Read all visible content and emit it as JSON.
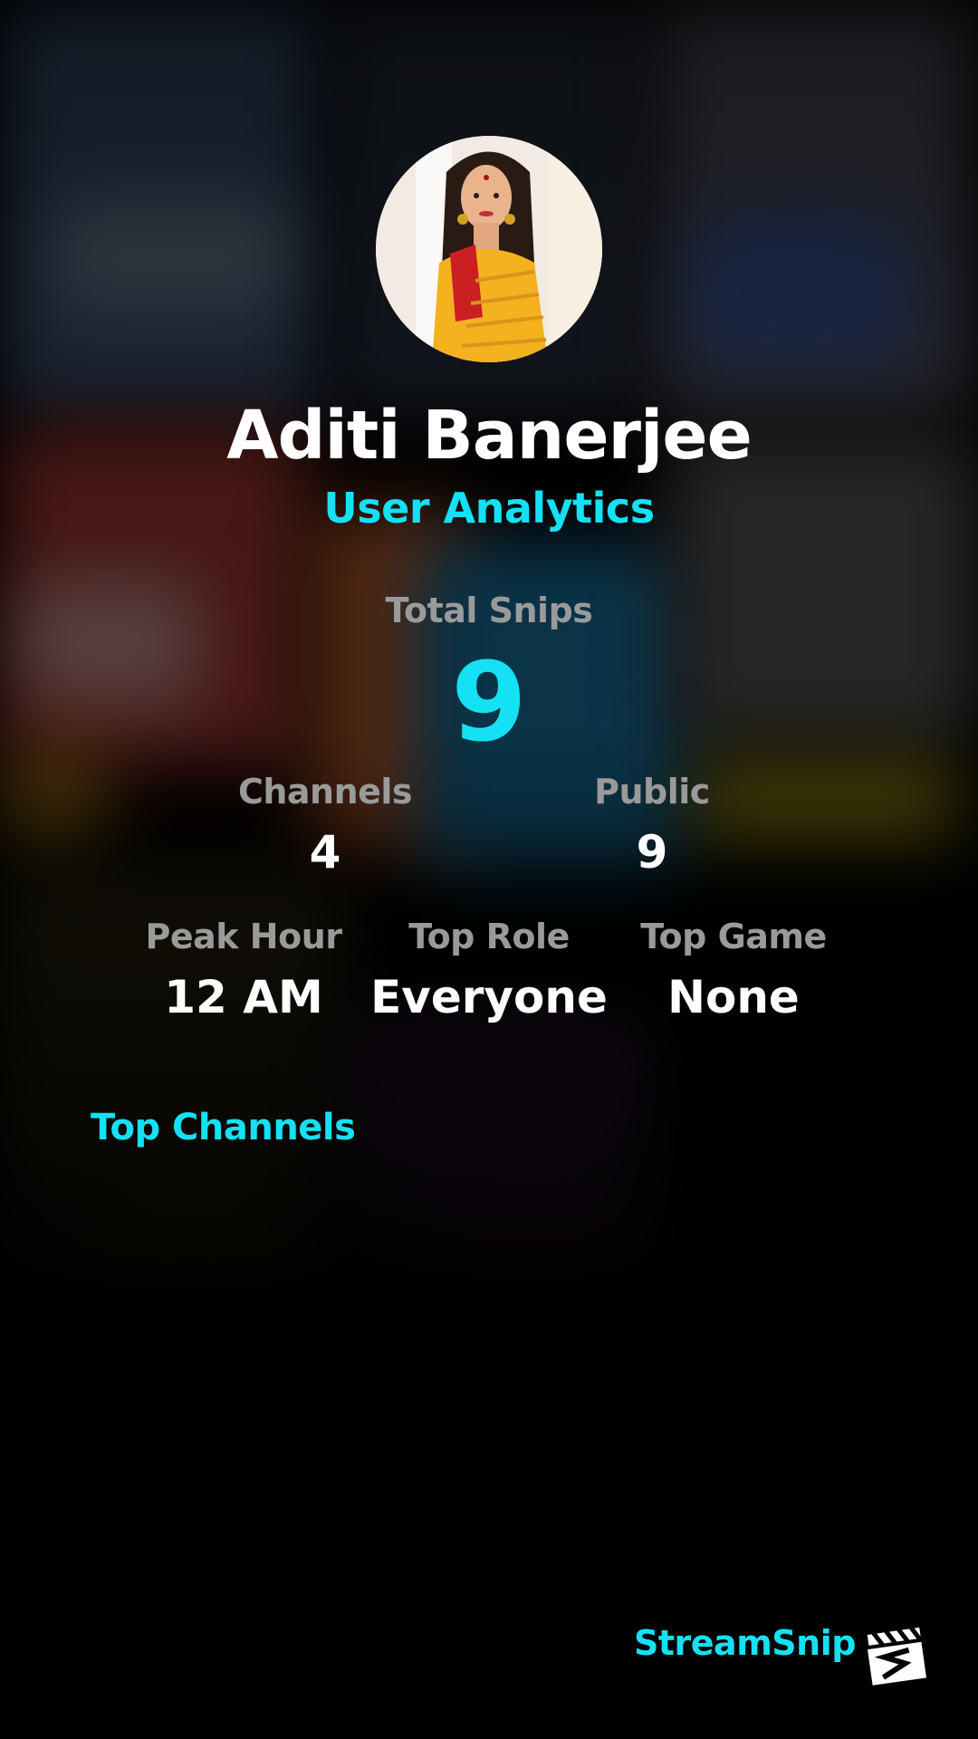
{
  "profile": {
    "name": "Aditi Banerjee",
    "subtitle": "User Analytics"
  },
  "stats": {
    "total_snips_label": "Total Snips",
    "total_snips_value": "9",
    "channels_label": "Channels",
    "channels_value": "4",
    "public_label": "Public",
    "public_value": "9",
    "peak_hour_label": "Peak Hour",
    "peak_hour_value": "12 AM",
    "top_role_label": "Top Role",
    "top_role_value": "Everyone",
    "top_game_label": "Top Game",
    "top_game_value": "None"
  },
  "sections": {
    "top_channels_heading": "Top Channels"
  },
  "branding": {
    "name": "StreamSnip",
    "logo_icon": "clapperboard-logo-icon"
  },
  "colors": {
    "accent": "#14e1f3",
    "label": "#9a9a9a",
    "background": "#000000",
    "text": "#ffffff"
  }
}
